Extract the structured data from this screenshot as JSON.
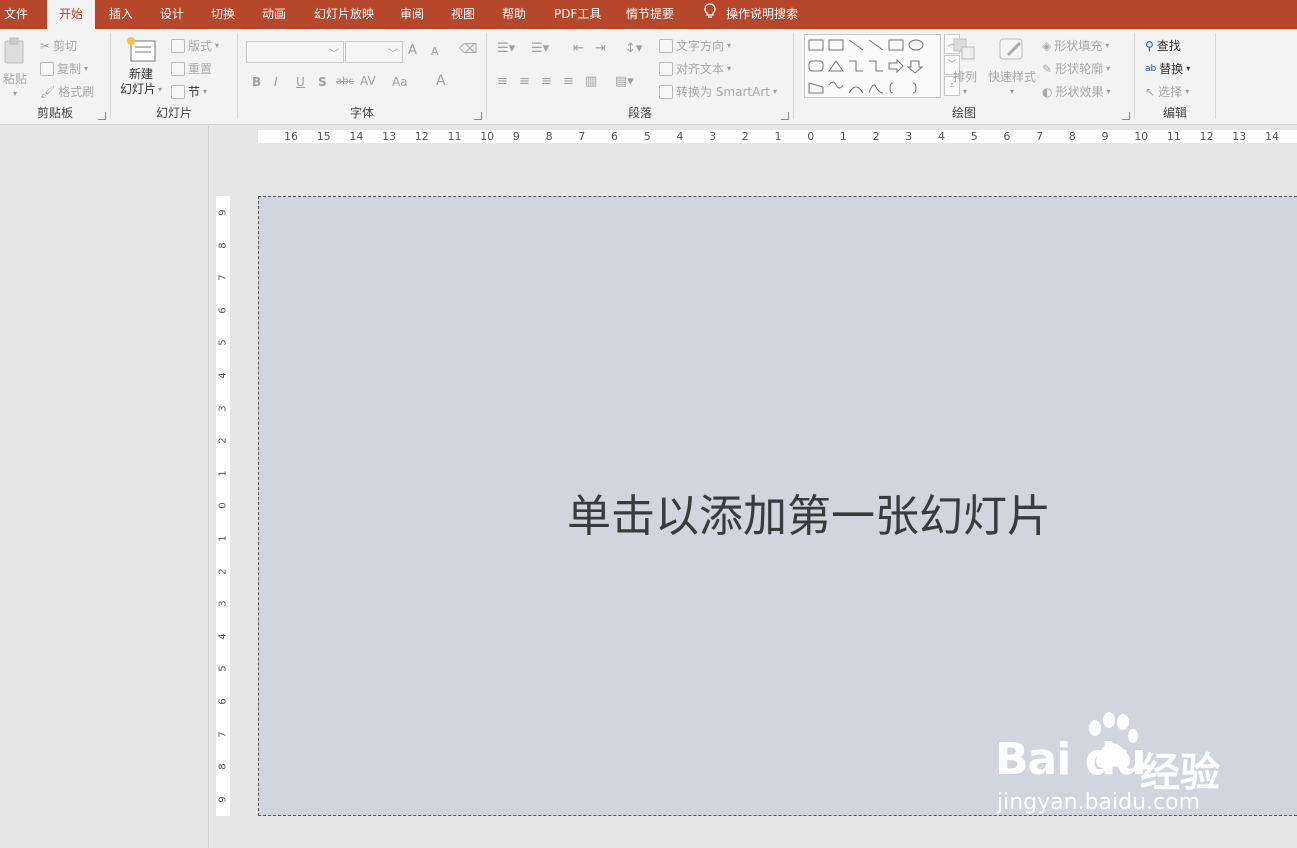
{
  "tabs": {
    "file": "文件",
    "home": "开始",
    "insert": "插入",
    "design": "设计",
    "transitions": "切换",
    "animations": "动画",
    "slideshow": "幻灯片放映",
    "review": "审阅",
    "view": "视图",
    "help": "帮助",
    "pdf": "PDF工具",
    "storyboard": "情节提要",
    "tell_me": "操作说明搜索"
  },
  "clipboard": {
    "paste": "粘贴",
    "cut": "剪切",
    "copy": "复制",
    "format_painter": "格式刷",
    "label": "剪贴板"
  },
  "slides": {
    "new_slide_line1": "新建",
    "new_slide_line2": "幻灯片",
    "layout": "版式",
    "reset": "重置",
    "section": "节",
    "label": "幻灯片"
  },
  "font": {
    "label": "字体",
    "bold": "B",
    "italic": "I",
    "underline": "U",
    "shadow": "S",
    "strike": "abc",
    "spacing": "AV",
    "case": "Aa",
    "color": "A",
    "grow": "A",
    "shrink": "A"
  },
  "paragraph": {
    "text_direction": "文字方向",
    "align_text": "对齐文本",
    "smartart": "转换为 SmartArt",
    "label": "段落"
  },
  "drawing": {
    "arrange": "排列",
    "quick_styles": "快速样式",
    "shape_fill": "形状填充",
    "shape_outline": "形状轮廓",
    "shape_effects": "形状效果",
    "label": "绘图"
  },
  "editing": {
    "find": "查找",
    "replace": "替换",
    "select": "选择",
    "label": "编辑"
  },
  "ruler": {
    "h_ticks": [
      "16",
      "15",
      "14",
      "13",
      "12",
      "11",
      "10",
      "9",
      "8",
      "7",
      "6",
      "5",
      "4",
      "3",
      "2",
      "1",
      "0",
      "1",
      "2",
      "3",
      "4",
      "5",
      "6",
      "7",
      "8",
      "9",
      "10",
      "11",
      "12",
      "13",
      "14"
    ],
    "v_ticks": [
      "9",
      "8",
      "7",
      "6",
      "5",
      "4",
      "3",
      "2",
      "1",
      "0",
      "1",
      "2",
      "3",
      "4",
      "5",
      "6",
      "7",
      "8",
      "9"
    ]
  },
  "slide": {
    "placeholder": "单击以添加第一张幻灯片"
  },
  "watermark": {
    "logo": "Bai du",
    "cn": "经验",
    "url": "jingyan.baidu.com"
  },
  "colors": {
    "tab_bar": "#b7472a",
    "ribbon": "#f3f3f3",
    "slide_bg": "#d1d5de",
    "workspace": "#e6e6e6"
  }
}
